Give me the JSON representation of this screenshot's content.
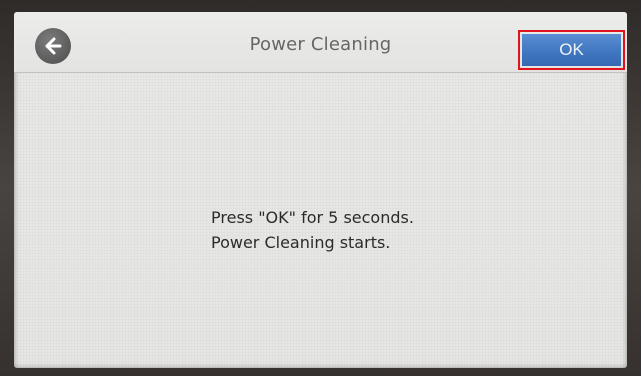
{
  "header": {
    "title": "Power Cleaning",
    "back_icon": "arrow-left-icon",
    "ok_label": "OK"
  },
  "message": {
    "line1": "Press \"OK\" for 5 seconds.",
    "line2": "Power Cleaning starts."
  },
  "colors": {
    "ok_button": "#4479c3",
    "highlight_border": "#e0141c",
    "back_button": "#5f5f5f",
    "screen_background": "#e7e7e5"
  }
}
